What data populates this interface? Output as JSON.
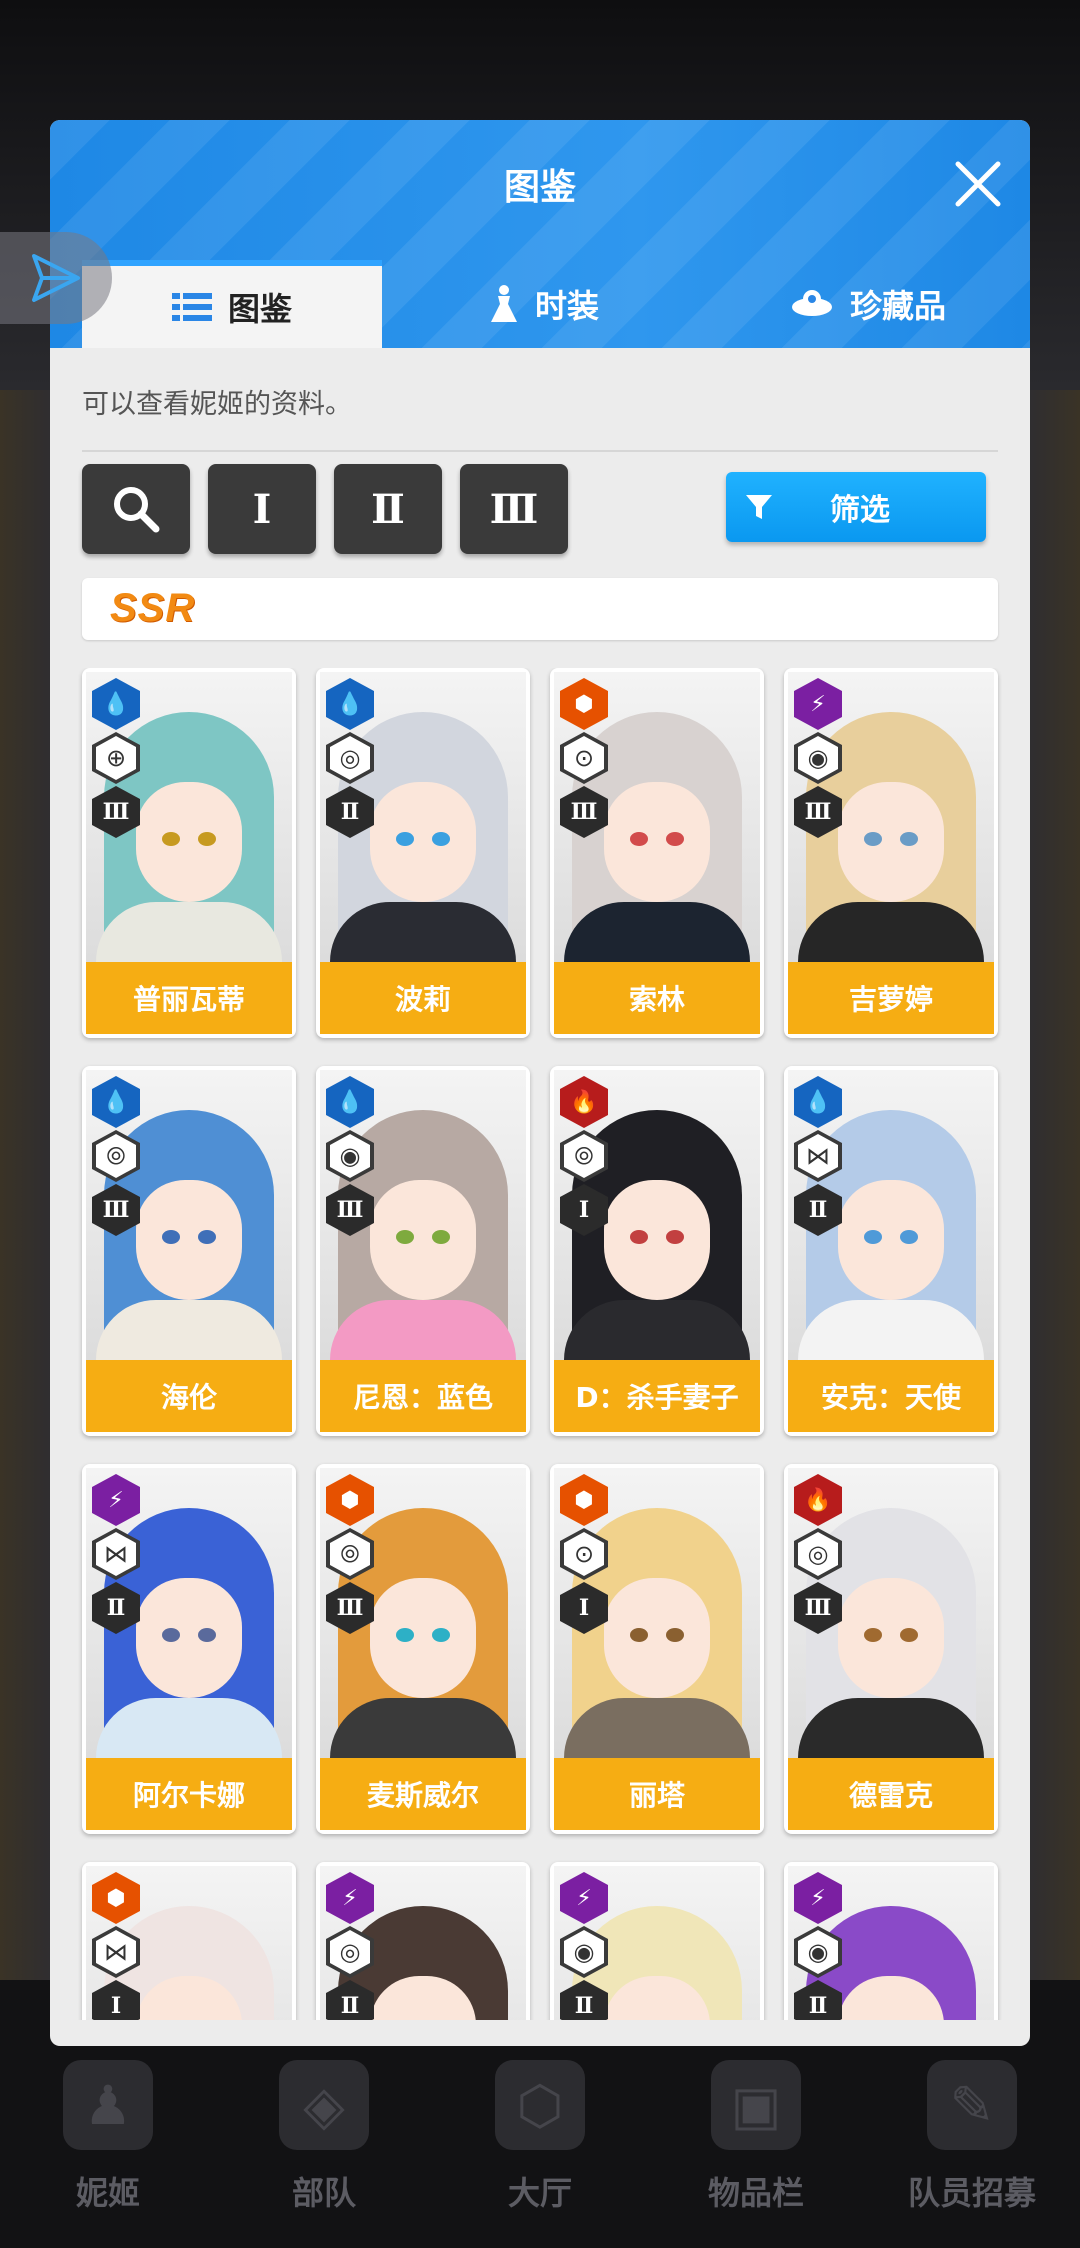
{
  "modal": {
    "title": "图鉴",
    "tabs": [
      "图鉴",
      "时装",
      "珍藏品"
    ],
    "description": "可以查看妮姬的资料。",
    "tools": [
      "Ⅰ",
      "Ⅱ",
      "Ⅲ"
    ],
    "filter_label": "筛选",
    "rarity_label": "SSR"
  },
  "colors": {
    "header_blue": "#1e88e5",
    "name_bar": "#f6ad13",
    "filter_button": "#0fa0f5",
    "water": "#1565c0",
    "fire": "#b71c1c",
    "wind": "#8e24aa",
    "iron": "#e65100",
    "electric": "#7b1fa2"
  },
  "cards": [
    {
      "name": "普丽瓦蒂",
      "element": "water",
      "burst": "Ⅲ",
      "class_icon": "crosshair-icon",
      "hair": "#7ec6c4",
      "outfit": "#e8e8e0",
      "eye": "#c79a20"
    },
    {
      "name": "波莉",
      "element": "water",
      "burst": "Ⅱ",
      "class_icon": "target-icon",
      "hair": "#d2d6de",
      "outfit": "#2a2c33",
      "eye": "#3aa0e0"
    },
    {
      "name": "索林",
      "element": "iron",
      "burst": "Ⅲ",
      "class_icon": "scope-icon",
      "hair": "#d8d2d0",
      "outfit": "#1c2430",
      "eye": "#d24b4b"
    },
    {
      "name": "吉萝婷",
      "element": "electric",
      "burst": "Ⅲ",
      "class_icon": "circle-icon",
      "hair": "#e8cf9c",
      "outfit": "#262626",
      "eye": "#6a9cc6"
    },
    {
      "name": "海伦",
      "element": "water",
      "burst": "Ⅲ",
      "class_icon": "bracket-icon",
      "hair": "#4f8fd4",
      "outfit": "#efeae0",
      "eye": "#3f6fb8"
    },
    {
      "name": "尼恩：蓝色",
      "element": "water",
      "burst": "Ⅲ",
      "class_icon": "circle-icon",
      "hair": "#b7a9a3",
      "outfit": "#f39ac4",
      "eye": "#7eaa3e"
    },
    {
      "name": "D：杀手妻子",
      "element": "fire",
      "burst": "Ⅰ",
      "class_icon": "bracket-icon",
      "hair": "#1f1f24",
      "outfit": "#2a2a2e",
      "eye": "#c24040"
    },
    {
      "name": "安克：天使",
      "element": "water",
      "burst": "Ⅱ",
      "class_icon": "split-icon",
      "hair": "#b4cbe8",
      "outfit": "#f3f3f3",
      "eye": "#4f9ad8"
    },
    {
      "name": "阿尔卡娜",
      "element": "electric",
      "burst": "Ⅱ",
      "class_icon": "split-icon",
      "hair": "#3a62d6",
      "outfit": "#d8e8f4",
      "eye": "#5a6a9c"
    },
    {
      "name": "麦斯威尔",
      "element": "iron",
      "burst": "Ⅲ",
      "class_icon": "bracket-icon",
      "hair": "#e39b3c",
      "outfit": "#3a3a3a",
      "eye": "#2db0c6"
    },
    {
      "name": "丽塔",
      "element": "iron",
      "burst": "Ⅰ",
      "class_icon": "scope-icon",
      "hair": "#f1d28c",
      "outfit": "#7a6e60",
      "eye": "#8a6030"
    },
    {
      "name": "德雷克",
      "element": "fire",
      "burst": "Ⅲ",
      "class_icon": "target-icon",
      "hair": "#e2e2e6",
      "outfit": "#2a2a2a",
      "eye": "#a06a30"
    },
    {
      "name": "",
      "element": "iron",
      "burst": "Ⅰ",
      "class_icon": "split-icon",
      "hair": "#efe4e2",
      "outfit": "#e8e2e2",
      "eye": "#d24b6a"
    },
    {
      "name": "",
      "element": "electric",
      "burst": "Ⅱ",
      "class_icon": "target-icon",
      "hair": "#4a3a34",
      "outfit": "#3a3030",
      "eye": "#8a6030"
    },
    {
      "name": "",
      "element": "electric",
      "burst": "Ⅱ",
      "class_icon": "circle-icon",
      "hair": "#f0e6b8",
      "outfit": "#e8e2c0",
      "eye": "#6a8ab0"
    },
    {
      "name": "",
      "element": "electric",
      "burst": "Ⅱ",
      "class_icon": "circle-icon",
      "hair": "#8a4ac8",
      "outfit": "#5a3a8a",
      "eye": "#6a3aa0"
    }
  ],
  "background_nav": [
    "妮姬",
    "部队",
    "大厅",
    "物品栏",
    "队员招募"
  ]
}
